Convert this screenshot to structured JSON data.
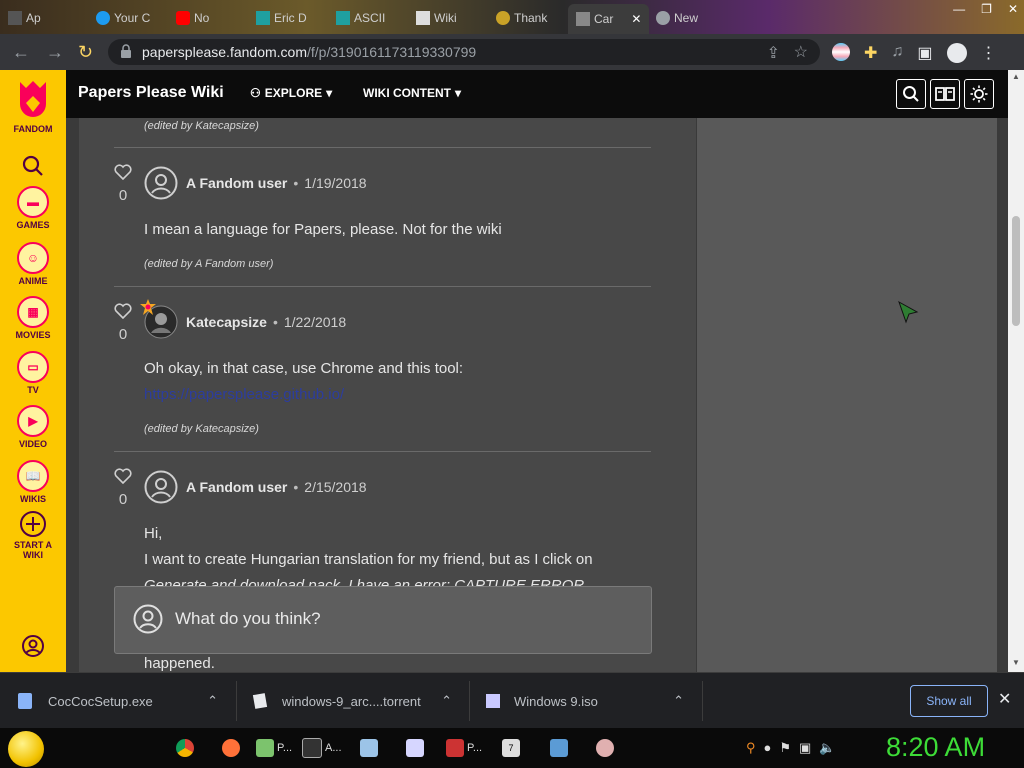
{
  "browser": {
    "tabs": [
      {
        "label": "Ap"
      },
      {
        "label": "Your C"
      },
      {
        "label": "No"
      },
      {
        "label": "Eric D"
      },
      {
        "label": "ASCII"
      },
      {
        "label": "Wiki"
      },
      {
        "label": "Thank"
      },
      {
        "label": "Car"
      },
      {
        "label": "New"
      }
    ],
    "url_host": "papersplease.fandom.com",
    "url_path": "/f/p/3190161173119330799"
  },
  "rail": {
    "items": [
      {
        "label": "FANDOM",
        "icon": "fandom-logo-icon"
      },
      {
        "label": "",
        "icon": "search-icon"
      },
      {
        "label": "GAMES",
        "icon": "games-icon"
      },
      {
        "label": "ANIME",
        "icon": "anime-icon"
      },
      {
        "label": "MOVIES",
        "icon": "movies-icon"
      },
      {
        "label": "TV",
        "icon": "tv-icon"
      },
      {
        "label": "VIDEO",
        "icon": "video-icon"
      },
      {
        "label": "WIKIS",
        "icon": "wikis-icon"
      },
      {
        "label": "START A",
        "label2": "WIKI",
        "icon": "plus-circle-icon"
      }
    ]
  },
  "header": {
    "title": "Papers Please Wiki",
    "explore": "EXPLORE",
    "wiki_content": "WIKI CONTENT"
  },
  "thread": {
    "top_edited": "(edited by Katecapsize)",
    "posts": [
      {
        "likes": "0",
        "author": "A Fandom user",
        "date": "1/19/2018",
        "body": "I mean a language for Papers, please. Not for the wiki",
        "edited": "(edited by A Fandom user)"
      },
      {
        "likes": "0",
        "author": "Katecapsize",
        "date": "1/22/2018",
        "body": "Oh okay, in that case, use Chrome and this tool:",
        "link": "https://papersplease.github.io/",
        "edited": "(edited by Katecapsize)"
      },
      {
        "likes": "0",
        "author": "A Fandom user",
        "date": "2/15/2018",
        "body_lines": [
          "Hi,",
          "I want to create Hungarian translation for my friend, but as I click on",
          "Generate and download pack, I have an error: CAPTURE ERROR",
          "happened."
        ]
      }
    ],
    "reply_placeholder": "What do you think?"
  },
  "downloads": {
    "items": [
      {
        "name": "CocCocSetup.exe"
      },
      {
        "name": "windows-9_arc....torrent"
      },
      {
        "name": "Windows 9.iso"
      }
    ],
    "show_all": "Show all"
  },
  "taskbar": {
    "items": [
      {
        "label": "P..."
      },
      {
        "label": "A..."
      },
      {
        "label": "P..."
      },
      {
        "label": "7"
      }
    ],
    "clock": "8:20 AM"
  }
}
